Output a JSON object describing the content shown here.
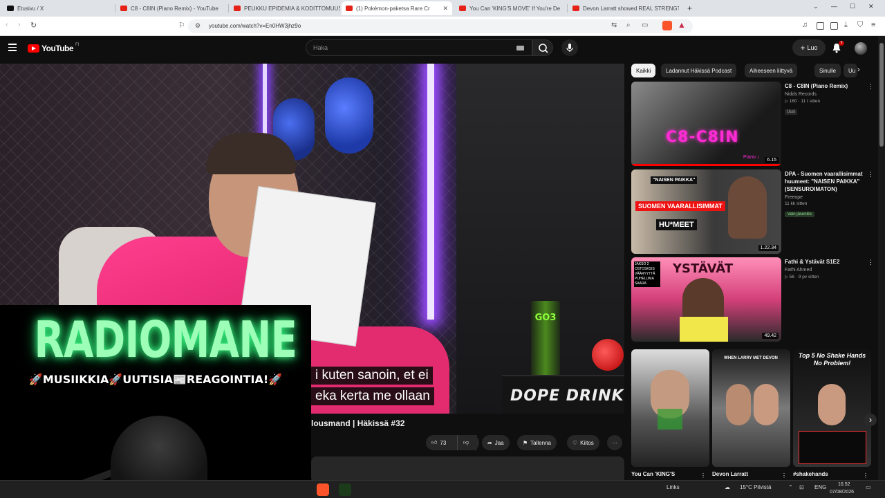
{
  "browser": {
    "tabs": [
      {
        "label": "Etusivu / X",
        "icon": "x-logo-icon"
      },
      {
        "label": "C8 - C8IN (Piano Remix) - YouTube",
        "icon": "youtube-icon"
      },
      {
        "label": "PEUKKU EPIDEMIA & KODITTOMUUS",
        "icon": "youtube-icon"
      },
      {
        "label": "(1) Pokémon-paketsa Rare Cr",
        "icon": "youtube-icon",
        "active": true
      },
      {
        "label": "You Can 'KING'S MOVE' If You're De",
        "icon": "youtube-icon"
      },
      {
        "label": "Devon Larratt showed REAL STRENGT",
        "icon": "youtube-icon"
      }
    ],
    "new_tab": "+",
    "url": "youtube.com/watch?v=En0HW3jhz9o"
  },
  "youtube": {
    "logo_text": "YouTube",
    "country": "FI",
    "search_placeholder": "Haka",
    "create_label": "Luo",
    "notification_count": "9"
  },
  "video": {
    "title_fragment": "lousmand | Häkissä #32",
    "captions": [
      "i kuten sanoin, et ei",
      "eka kerta me ollaan"
    ],
    "scene_text": {
      "can": "GO3",
      "cooler": "DOPE DRINK"
    },
    "actions": {
      "like_count": "73",
      "share": "Jaa",
      "save": "Tallenna",
      "thanks": "Kiitos",
      "more": "···"
    }
  },
  "overlay": {
    "title": "RADIOMANE",
    "subtitle": "🚀MUSIIKKIA🚀UUTISIA📰REAGOINTIA!🚀"
  },
  "sidebar": {
    "chips": [
      "Kaikki",
      "Ladannut Häkissä Podcast",
      "Aiheeseen liittyvä",
      "Sinulle",
      "Uu"
    ],
    "videos": [
      {
        "title": "C8 - C8IN (Piano Remix)",
        "channel": "Nidds Records",
        "meta": "▷ 160 · 11 t sitten",
        "badge": "Uusi",
        "duration": "6.15",
        "thumb_text": "C8-C8IN",
        "thumb_corner": "Piano ♪"
      },
      {
        "title": "DPA - Suomen vaarallisimmat huumeet: \"NAISEN PAIKKA\" (SENSUROIMATON)",
        "channel": "Freeope",
        "meta": "11 kk sitten",
        "badge": "Vain jäsenille",
        "duration": "1.22.34",
        "thumb_text": "SUOMEN VAARALLISIMMAT",
        "thumb_top": "\"NAISEN PAIKKA\"",
        "thumb_bottom": "HU*MEET"
      },
      {
        "title": "Fathi & Ystävät S1E2",
        "channel": "Fathi Ahmed",
        "meta": "▷ 56 · 9 pv sitten",
        "duration": "49.42",
        "thumb_text": "YSTÄVÄT",
        "thumb_left": "JAKSO 2 OSTOSKSIS VÄÄRYYTTÄ PUHELUMA SAARA"
      }
    ],
    "shorts": [
      {
        "title": "You Can 'KING'S",
        "overlay": ""
      },
      {
        "title": "Devon Larratt",
        "overlay": "WHEN LARRY MET DEVON"
      },
      {
        "title": "#shakehands",
        "overlay": "Top 5 No Shake Hands No Problem!"
      }
    ]
  },
  "taskbar": {
    "links": "Links",
    "weather": "15°C Pilvistä",
    "lang": "ENG",
    "time": "16.52",
    "date": "07/08/2026"
  },
  "colors": {
    "yt_red": "#ff0000",
    "neon_green": "#9dffb7",
    "pink_hoodie": "#ff3f8e"
  }
}
